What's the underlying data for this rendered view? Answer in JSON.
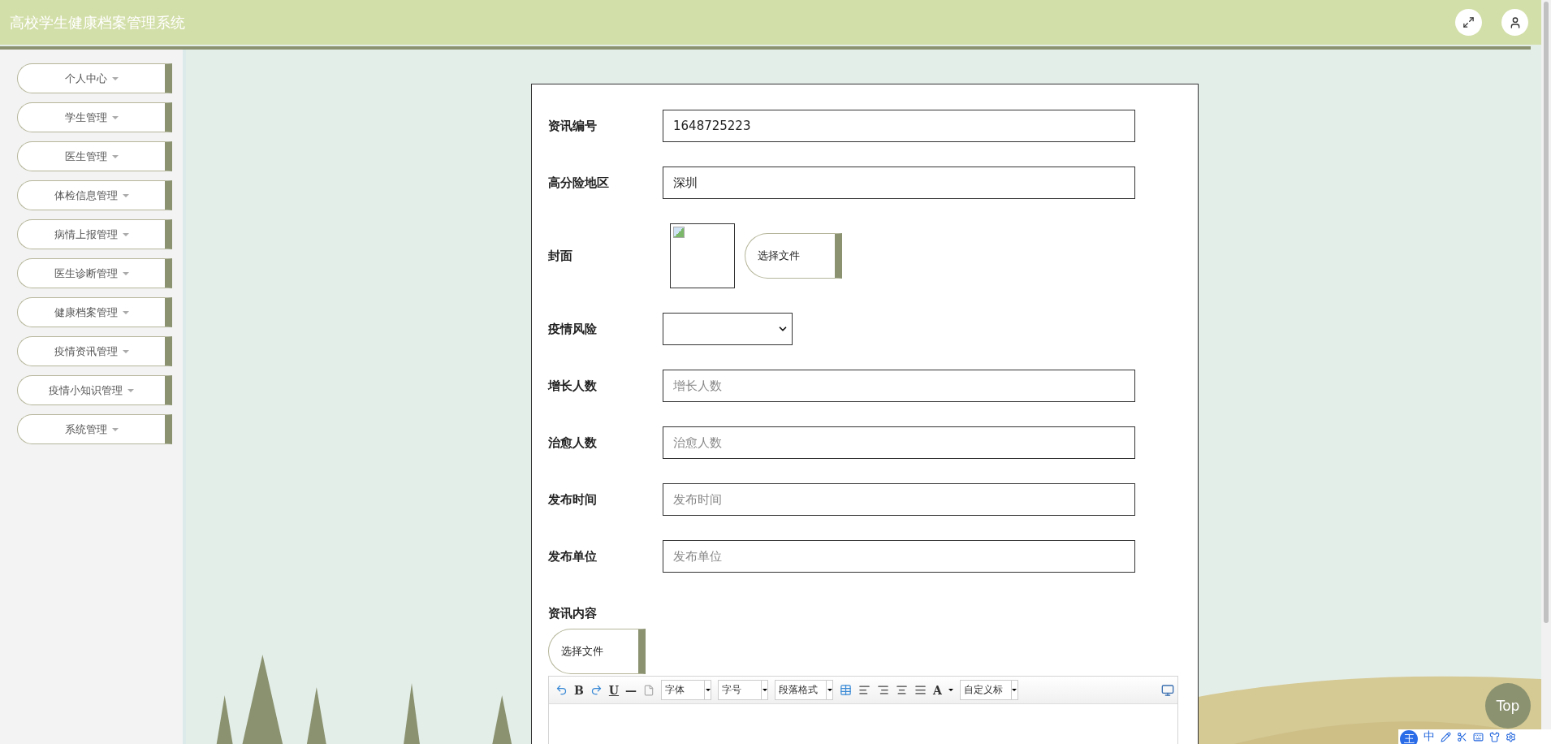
{
  "header": {
    "title": "高校学生健康档案管理系统"
  },
  "sidebar": {
    "items": [
      {
        "label": "个人中心"
      },
      {
        "label": "学生管理"
      },
      {
        "label": "医生管理"
      },
      {
        "label": "体检信息管理"
      },
      {
        "label": "病情上报管理"
      },
      {
        "label": "医生诊断管理"
      },
      {
        "label": "健康档案管理"
      },
      {
        "label": "疫情资讯管理"
      },
      {
        "label": "疫情小知识管理"
      },
      {
        "label": "系统管理"
      }
    ]
  },
  "form": {
    "fields": [
      {
        "kind": "text",
        "label": "资讯编号",
        "value": "1648725223"
      },
      {
        "kind": "text",
        "label": "高分险地区",
        "value": "深圳"
      },
      {
        "kind": "image",
        "label": "封面",
        "button": "选择文件"
      },
      {
        "kind": "select",
        "label": "疫情风险"
      },
      {
        "kind": "text",
        "label": "增长人数",
        "placeholder": "增长人数"
      },
      {
        "kind": "text",
        "label": "治愈人数",
        "placeholder": "治愈人数"
      },
      {
        "kind": "text",
        "label": "发布时间",
        "placeholder": "发布时间"
      },
      {
        "kind": "text",
        "label": "发布单位",
        "placeholder": "发布单位"
      },
      {
        "kind": "richtext",
        "label": "资讯内容",
        "button": "选择文件"
      }
    ]
  },
  "editor_toolbar": {
    "bold": "B",
    "underline": "U",
    "rule": "—",
    "font": "字体",
    "size": "字号",
    "paragraph": "段落格式",
    "font_color": "A",
    "heading": "自定义标"
  },
  "top_button": "Top",
  "ime_bar": {
    "logo": "王",
    "mode": "中"
  }
}
